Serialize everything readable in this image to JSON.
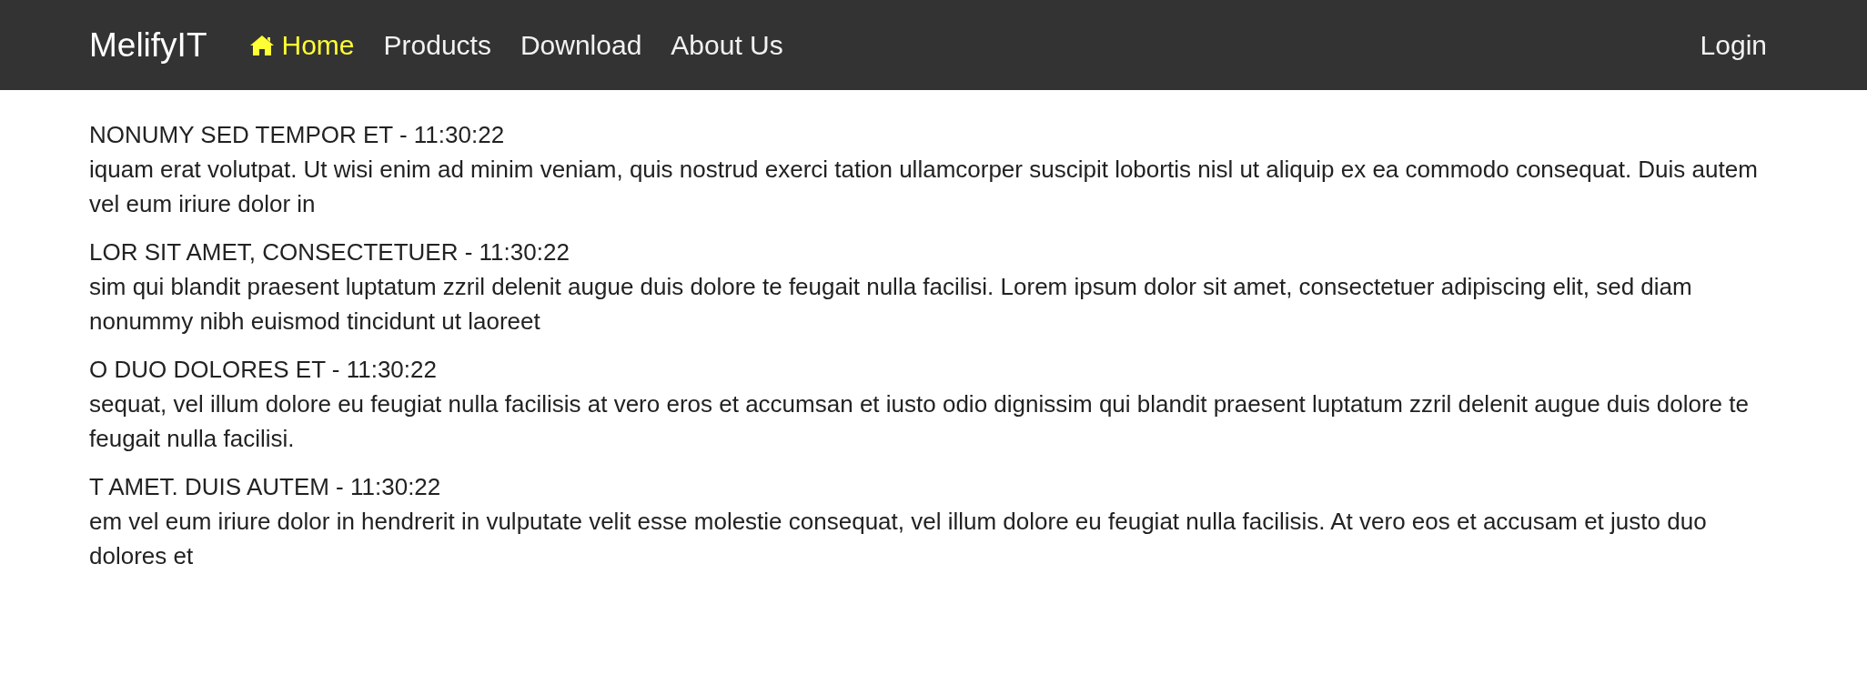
{
  "navbar": {
    "brand": "MelifyIT",
    "items": [
      {
        "label": "Home",
        "kind": "home",
        "selected": true
      },
      {
        "label": "Products",
        "kind": "link",
        "selected": false
      },
      {
        "label": "Download",
        "kind": "link",
        "selected": false
      },
      {
        "label": "About Us",
        "kind": "link",
        "selected": false
      }
    ],
    "login": "Login"
  },
  "posts": [
    {
      "heading": "NONUMY SED TEMPOR ET - 11:30:22",
      "body": "iquam erat volutpat. Ut wisi enim ad minim veniam, quis nostrud exerci tation ullamcorper suscipit lobortis nisl ut aliquip ex ea commodo consequat. Duis autem vel eum iriure dolor in"
    },
    {
      "heading": "LOR SIT AMET, CONSECTETUER - 11:30:22",
      "body": "sim qui blandit praesent luptatum zzril delenit augue duis dolore te feugait nulla facilisi. Lorem ipsum dolor sit amet, consectetuer adipiscing elit, sed diam nonummy nibh euismod tincidunt ut laoreet"
    },
    {
      "heading": "O DUO DOLORES ET - 11:30:22",
      "body": "sequat, vel illum dolore eu feugiat nulla facilisis at vero eros et accumsan et iusto odio dignissim qui blandit praesent luptatum zzril delenit augue duis dolore te feugait nulla facilisi."
    },
    {
      "heading": "T AMET. DUIS AUTEM - 11:30:22",
      "body": "em vel eum iriure dolor in hendrerit in vulputate velit esse molestie consequat, vel illum dolore eu feugiat nulla facilisis. At vero eos et accusam et justo duo dolores et"
    }
  ]
}
